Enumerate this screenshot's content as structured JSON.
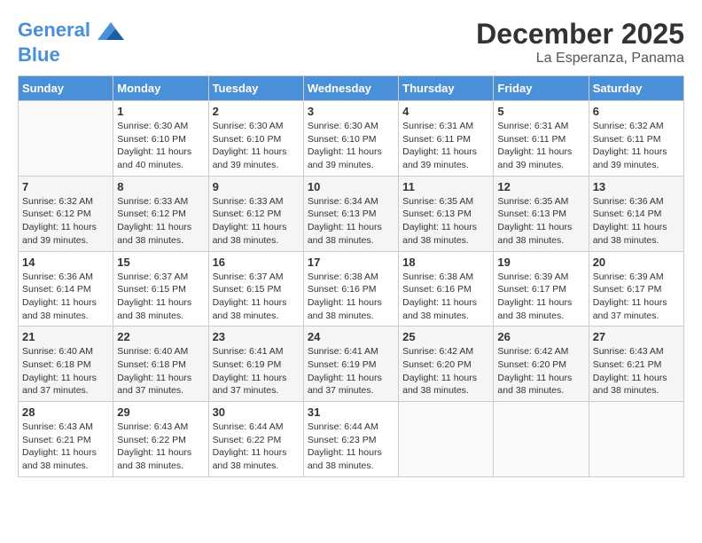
{
  "logo": {
    "line1": "General",
    "line2": "Blue"
  },
  "title": "December 2025",
  "location": "La Esperanza, Panama",
  "days_of_week": [
    "Sunday",
    "Monday",
    "Tuesday",
    "Wednesday",
    "Thursday",
    "Friday",
    "Saturday"
  ],
  "weeks": [
    [
      {
        "day": "",
        "info": ""
      },
      {
        "day": "1",
        "info": "Sunrise: 6:30 AM\nSunset: 6:10 PM\nDaylight: 11 hours\nand 40 minutes."
      },
      {
        "day": "2",
        "info": "Sunrise: 6:30 AM\nSunset: 6:10 PM\nDaylight: 11 hours\nand 39 minutes."
      },
      {
        "day": "3",
        "info": "Sunrise: 6:30 AM\nSunset: 6:10 PM\nDaylight: 11 hours\nand 39 minutes."
      },
      {
        "day": "4",
        "info": "Sunrise: 6:31 AM\nSunset: 6:11 PM\nDaylight: 11 hours\nand 39 minutes."
      },
      {
        "day": "5",
        "info": "Sunrise: 6:31 AM\nSunset: 6:11 PM\nDaylight: 11 hours\nand 39 minutes."
      },
      {
        "day": "6",
        "info": "Sunrise: 6:32 AM\nSunset: 6:11 PM\nDaylight: 11 hours\nand 39 minutes."
      }
    ],
    [
      {
        "day": "7",
        "info": "Sunrise: 6:32 AM\nSunset: 6:12 PM\nDaylight: 11 hours\nand 39 minutes."
      },
      {
        "day": "8",
        "info": "Sunrise: 6:33 AM\nSunset: 6:12 PM\nDaylight: 11 hours\nand 38 minutes."
      },
      {
        "day": "9",
        "info": "Sunrise: 6:33 AM\nSunset: 6:12 PM\nDaylight: 11 hours\nand 38 minutes."
      },
      {
        "day": "10",
        "info": "Sunrise: 6:34 AM\nSunset: 6:13 PM\nDaylight: 11 hours\nand 38 minutes."
      },
      {
        "day": "11",
        "info": "Sunrise: 6:35 AM\nSunset: 6:13 PM\nDaylight: 11 hours\nand 38 minutes."
      },
      {
        "day": "12",
        "info": "Sunrise: 6:35 AM\nSunset: 6:13 PM\nDaylight: 11 hours\nand 38 minutes."
      },
      {
        "day": "13",
        "info": "Sunrise: 6:36 AM\nSunset: 6:14 PM\nDaylight: 11 hours\nand 38 minutes."
      }
    ],
    [
      {
        "day": "14",
        "info": "Sunrise: 6:36 AM\nSunset: 6:14 PM\nDaylight: 11 hours\nand 38 minutes."
      },
      {
        "day": "15",
        "info": "Sunrise: 6:37 AM\nSunset: 6:15 PM\nDaylight: 11 hours\nand 38 minutes."
      },
      {
        "day": "16",
        "info": "Sunrise: 6:37 AM\nSunset: 6:15 PM\nDaylight: 11 hours\nand 38 minutes."
      },
      {
        "day": "17",
        "info": "Sunrise: 6:38 AM\nSunset: 6:16 PM\nDaylight: 11 hours\nand 38 minutes."
      },
      {
        "day": "18",
        "info": "Sunrise: 6:38 AM\nSunset: 6:16 PM\nDaylight: 11 hours\nand 38 minutes."
      },
      {
        "day": "19",
        "info": "Sunrise: 6:39 AM\nSunset: 6:17 PM\nDaylight: 11 hours\nand 38 minutes."
      },
      {
        "day": "20",
        "info": "Sunrise: 6:39 AM\nSunset: 6:17 PM\nDaylight: 11 hours\nand 37 minutes."
      }
    ],
    [
      {
        "day": "21",
        "info": "Sunrise: 6:40 AM\nSunset: 6:18 PM\nDaylight: 11 hours\nand 37 minutes."
      },
      {
        "day": "22",
        "info": "Sunrise: 6:40 AM\nSunset: 6:18 PM\nDaylight: 11 hours\nand 37 minutes."
      },
      {
        "day": "23",
        "info": "Sunrise: 6:41 AM\nSunset: 6:19 PM\nDaylight: 11 hours\nand 37 minutes."
      },
      {
        "day": "24",
        "info": "Sunrise: 6:41 AM\nSunset: 6:19 PM\nDaylight: 11 hours\nand 37 minutes."
      },
      {
        "day": "25",
        "info": "Sunrise: 6:42 AM\nSunset: 6:20 PM\nDaylight: 11 hours\nand 38 minutes."
      },
      {
        "day": "26",
        "info": "Sunrise: 6:42 AM\nSunset: 6:20 PM\nDaylight: 11 hours\nand 38 minutes."
      },
      {
        "day": "27",
        "info": "Sunrise: 6:43 AM\nSunset: 6:21 PM\nDaylight: 11 hours\nand 38 minutes."
      }
    ],
    [
      {
        "day": "28",
        "info": "Sunrise: 6:43 AM\nSunset: 6:21 PM\nDaylight: 11 hours\nand 38 minutes."
      },
      {
        "day": "29",
        "info": "Sunrise: 6:43 AM\nSunset: 6:22 PM\nDaylight: 11 hours\nand 38 minutes."
      },
      {
        "day": "30",
        "info": "Sunrise: 6:44 AM\nSunset: 6:22 PM\nDaylight: 11 hours\nand 38 minutes."
      },
      {
        "day": "31",
        "info": "Sunrise: 6:44 AM\nSunset: 6:23 PM\nDaylight: 11 hours\nand 38 minutes."
      },
      {
        "day": "",
        "info": ""
      },
      {
        "day": "",
        "info": ""
      },
      {
        "day": "",
        "info": ""
      }
    ]
  ]
}
